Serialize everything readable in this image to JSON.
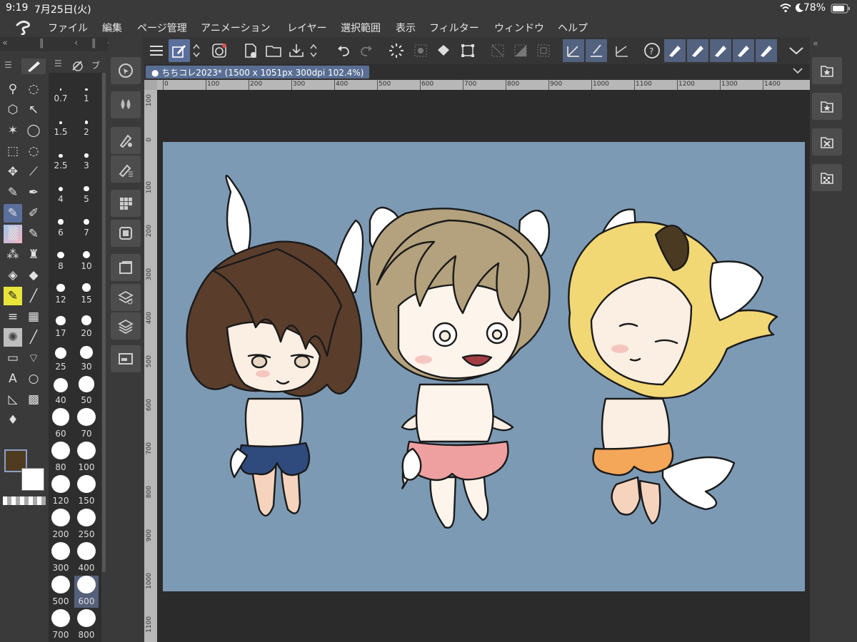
{
  "status": {
    "time": "9:19",
    "date": "7月25日(火)",
    "battery": "78%"
  },
  "menu": {
    "items": [
      "ファイル",
      "編集",
      "ページ管理",
      "アニメーション",
      "レイヤー",
      "選択範囲",
      "表示",
      "フィルター",
      "ウィンドウ",
      "ヘルプ"
    ]
  },
  "doc": {
    "tab_title": "ちちコレ2023* (1500 x 1051px 300dpi 102.4%)"
  },
  "ruler": {
    "h_labels": [
      "0",
      "100",
      "200",
      "300",
      "400",
      "500",
      "600",
      "700",
      "800",
      "900",
      "1000",
      "1100",
      "1200",
      "1300",
      "1400"
    ],
    "v_labels": [
      "100",
      "0",
      "100",
      "200",
      "300",
      "400",
      "500",
      "600",
      "700",
      "800",
      "900",
      "1000",
      "1100"
    ]
  },
  "brush_sizes": {
    "left": [
      "0.7",
      "1.5",
      "2.5",
      "4",
      "6",
      "8",
      "12",
      "17",
      "25",
      "40",
      "60",
      "80",
      "120",
      "200",
      "300",
      "500",
      "700"
    ],
    "right": [
      "1",
      "2",
      "3",
      "5",
      "7",
      "10",
      "15",
      "20",
      "30",
      "50",
      "70",
      "100",
      "150",
      "250",
      "400",
      "600",
      "800"
    ],
    "selected": "600"
  },
  "panel_tabs": {
    "brush_tab": "ブ"
  },
  "colors": {
    "main": "#4f3b20",
    "sub": "#ffffff",
    "canvas": "#7c9ab4",
    "accent": "#5b6f9c"
  }
}
